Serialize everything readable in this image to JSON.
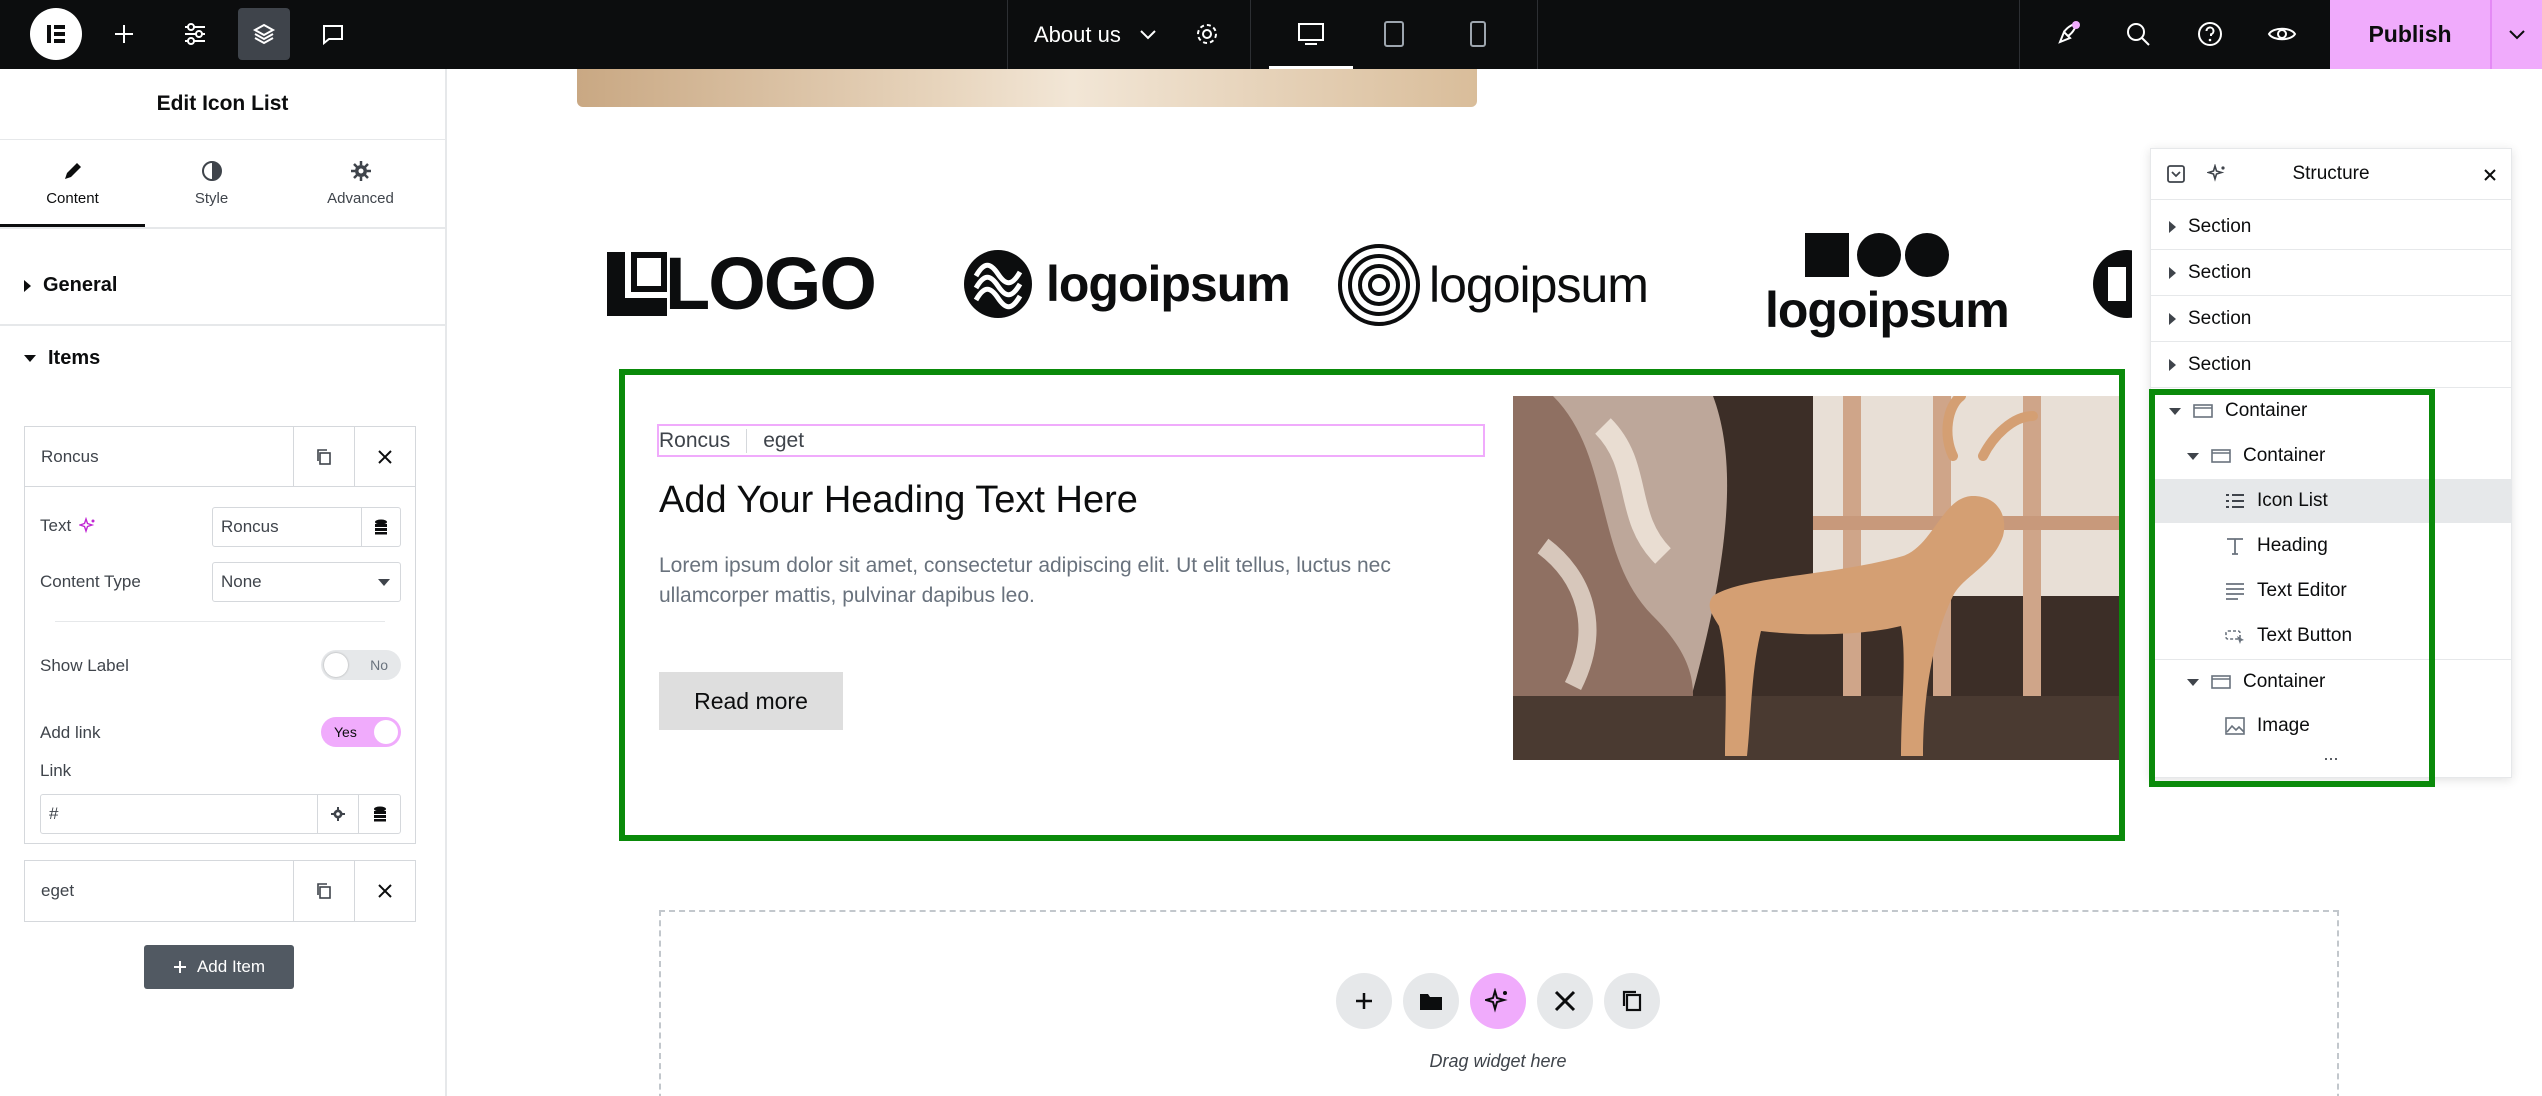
{
  "topbar": {
    "page_name": "About us",
    "publish_label": "Publish"
  },
  "panel": {
    "title": "Edit Icon List",
    "tabs": [
      {
        "label": "Content",
        "icon": "pencil-icon"
      },
      {
        "label": "Style",
        "icon": "half-circle-icon"
      },
      {
        "label": "Advanced",
        "icon": "gear-icon"
      }
    ],
    "section_general": "General",
    "section_items": "Items",
    "item1": {
      "title": "Roncus",
      "text_label": "Text",
      "text_value": "Roncus",
      "content_type_label": "Content Type",
      "content_type_value": "None",
      "show_label_label": "Show Label",
      "show_label_value": "No",
      "add_link_label": "Add link",
      "add_link_value": "Yes",
      "link_label": "Link",
      "link_value": "#"
    },
    "item2_title": "eget",
    "add_item_label": "Add Item"
  },
  "canvas": {
    "logos": [
      "LOGO",
      "logoipsum",
      "logoipsum",
      "logoipsum"
    ],
    "icon_list": [
      "Roncus",
      "eget"
    ],
    "heading": "Add Your Heading Text Here",
    "paragraph": "Lorem ipsum dolor sit amet, consectetur adipiscing elit. Ut elit tellus, luctus nec ullamcorper mattis, pulvinar dapibus leo.",
    "button": "Read more",
    "drag_hint": "Drag widget here"
  },
  "structure": {
    "title": "Structure",
    "rows": [
      {
        "label": "Section",
        "icon": "caret-right-icon"
      },
      {
        "label": "Section",
        "icon": "caret-right-icon"
      },
      {
        "label": "Section",
        "icon": "caret-right-icon"
      },
      {
        "label": "Section",
        "icon": "caret-right-icon"
      },
      {
        "label": "Container",
        "icon": "container-icon"
      },
      {
        "label": "Container",
        "icon": "container-icon"
      },
      {
        "label": "Icon List",
        "icon": "list-icon"
      },
      {
        "label": "Heading",
        "icon": "heading-icon"
      },
      {
        "label": "Text Editor",
        "icon": "text-editor-icon"
      },
      {
        "label": "Text Button",
        "icon": "button-icon"
      },
      {
        "label": "Container",
        "icon": "container-icon"
      },
      {
        "label": "Image",
        "icon": "image-icon"
      }
    ],
    "more": "..."
  },
  "colors": {
    "accent_pink": "#f0abfc",
    "highlight_green": "#0a8a0a",
    "topbar_bg": "#0c0d0e"
  }
}
